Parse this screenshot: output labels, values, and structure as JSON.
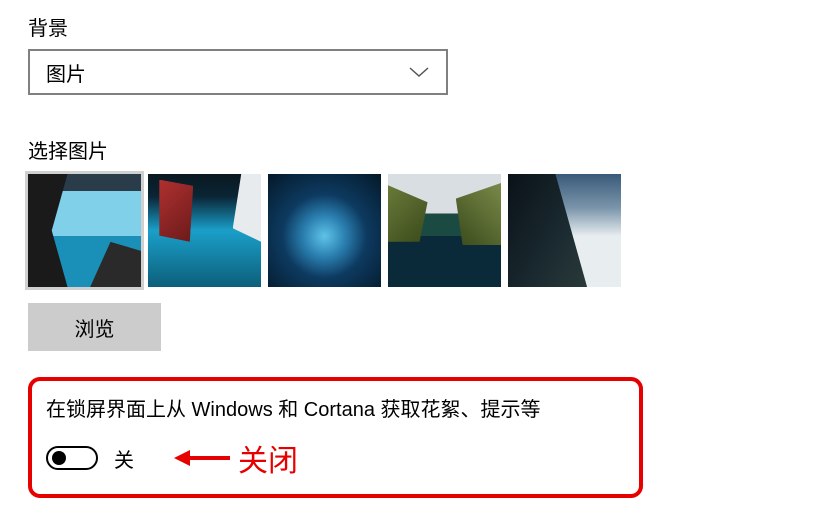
{
  "background": {
    "label": "背景",
    "dropdown_value": "图片"
  },
  "choose_picture": {
    "label": "选择图片",
    "browse_label": "浏览",
    "thumbs": [
      {
        "name": "cave-beach"
      },
      {
        "name": "boat-ocean"
      },
      {
        "name": "ice-cave"
      },
      {
        "name": "mountain-lake"
      },
      {
        "name": "hill-clouds"
      }
    ]
  },
  "tips_setting": {
    "title": "在锁屏界面上从 Windows 和 Cortana 获取花絮、提示等",
    "state_label": "关"
  },
  "annotation": {
    "text": "关闭",
    "color": "#e60000"
  }
}
